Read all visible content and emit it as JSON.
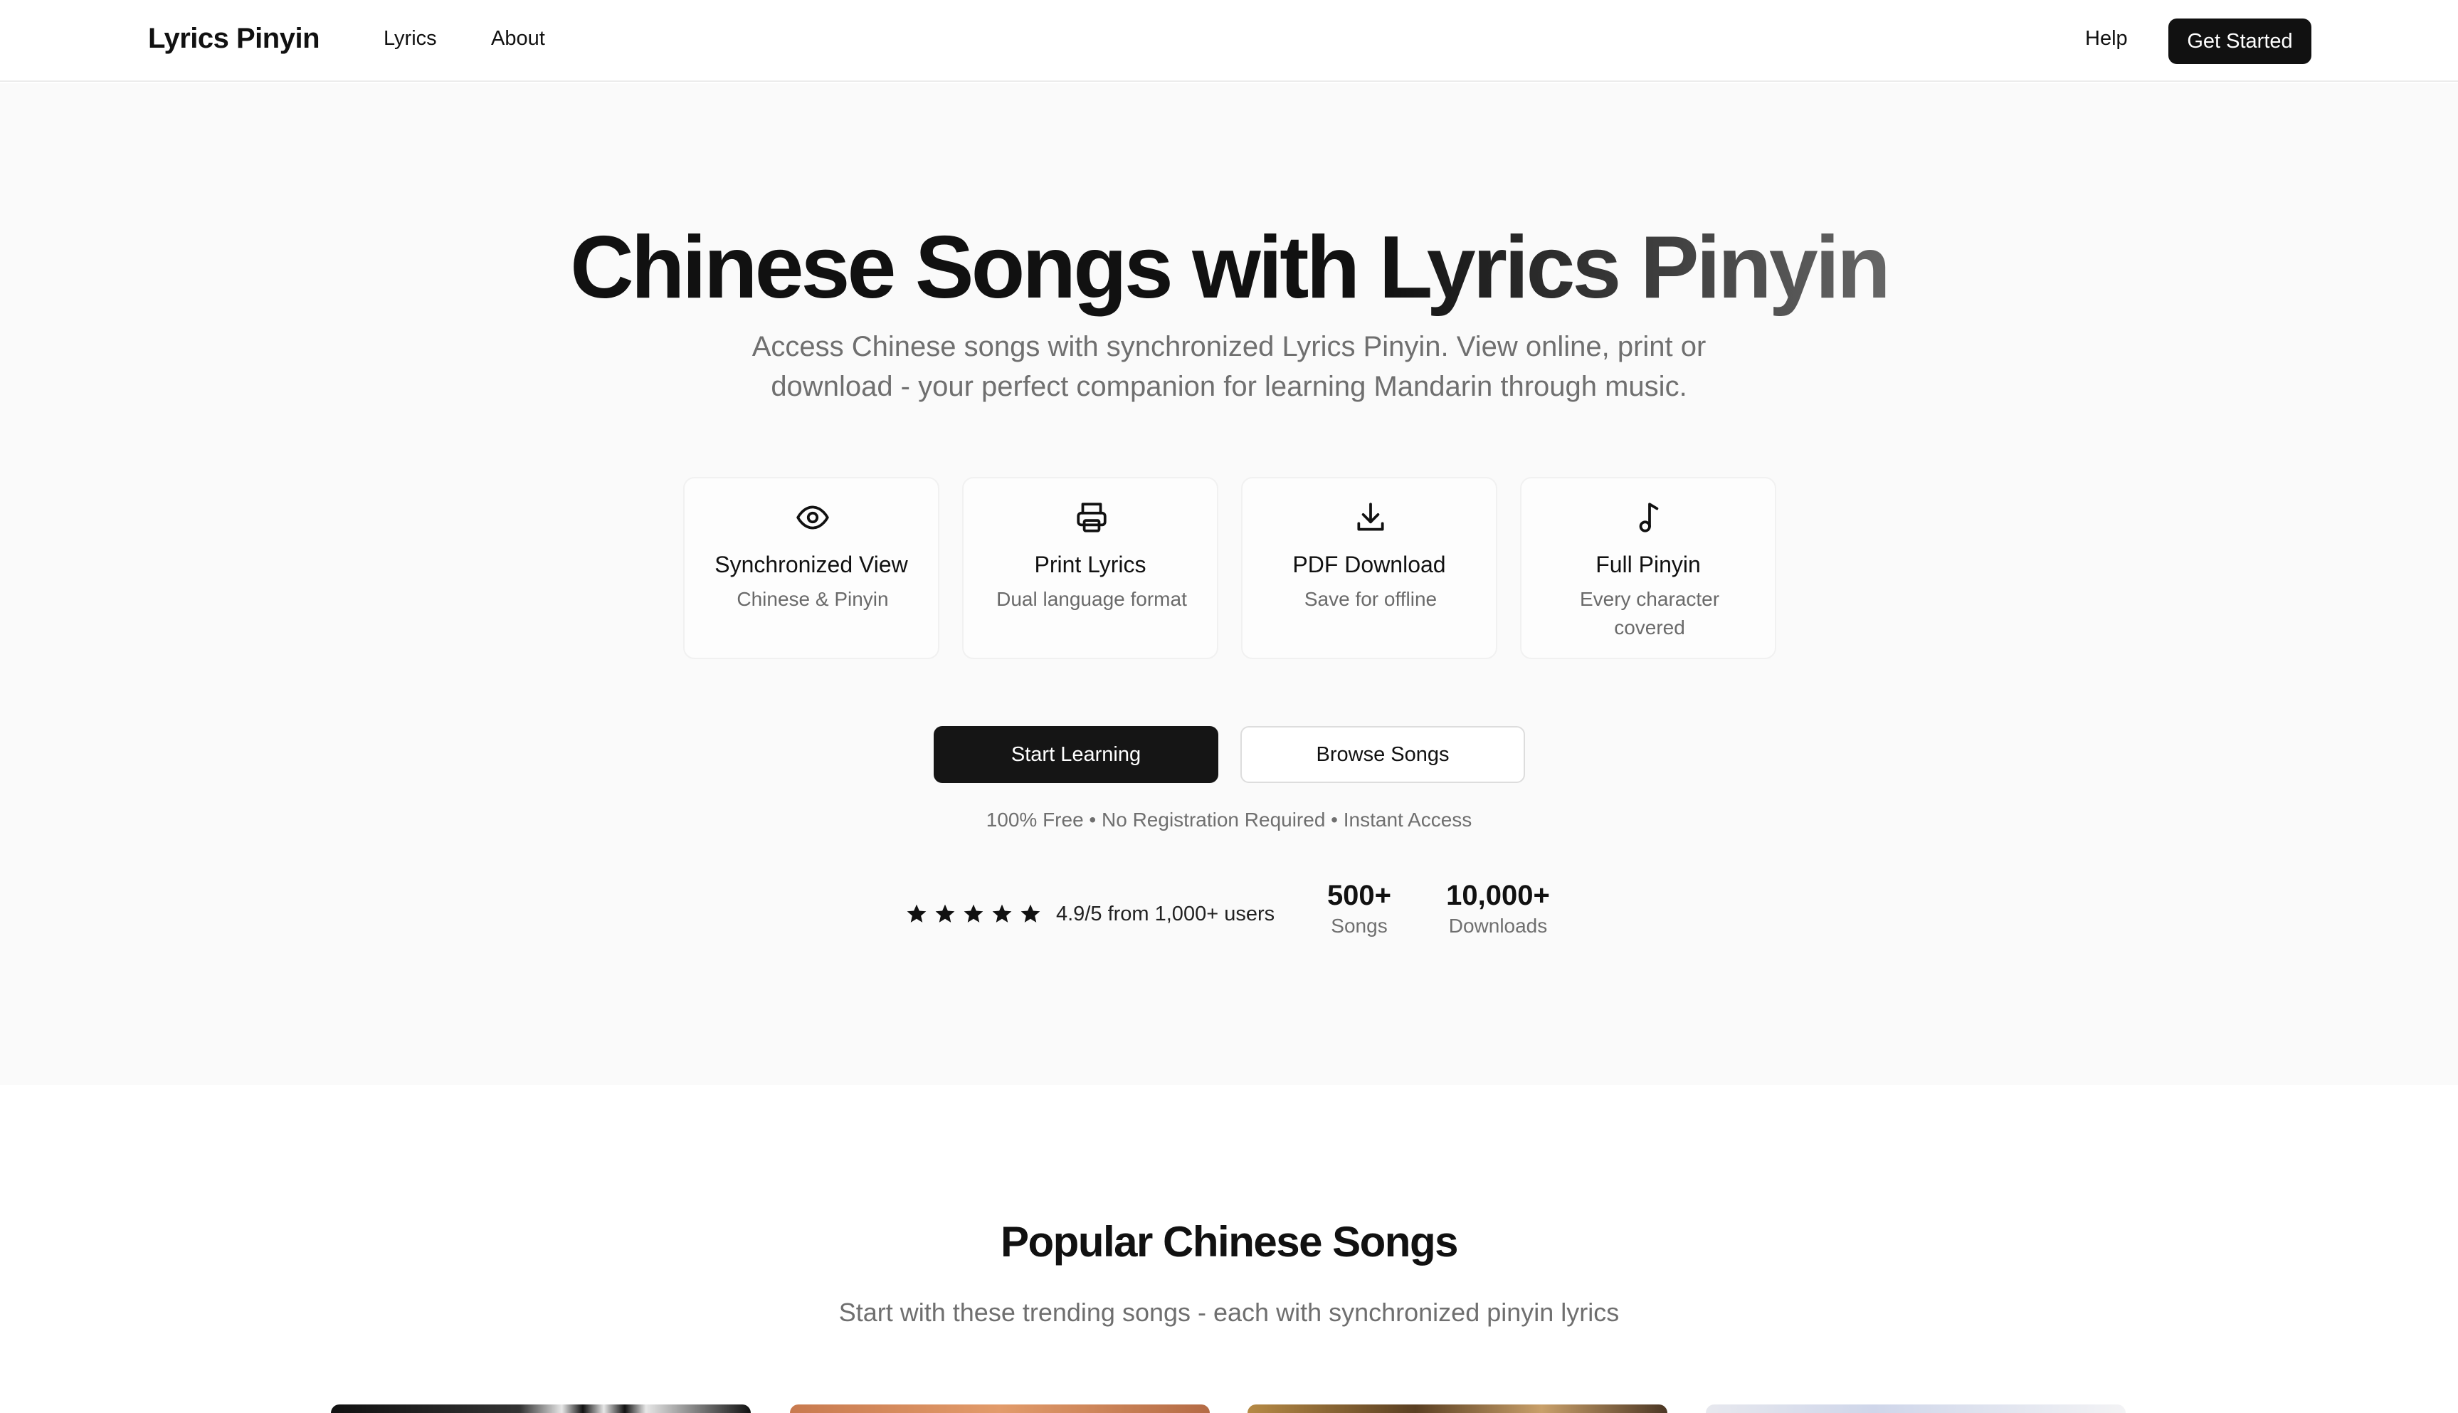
{
  "nav": {
    "logo": "Lyrics Pinyin",
    "links": [
      "Lyrics",
      "About"
    ],
    "help": "Help",
    "cta": "Get Started"
  },
  "hero": {
    "title_main": "Chinese Songs with ",
    "title_accent": "Lyrics Pinyin",
    "subtitle": "Access Chinese songs with synchronized Lyrics Pinyin. View online, print or download - your perfect companion for learning Mandarin through music.",
    "features": [
      {
        "icon": "eye-icon",
        "title": "Synchronized View",
        "desc": "Chinese & Pinyin"
      },
      {
        "icon": "printer-icon",
        "title": "Print Lyrics",
        "desc": "Dual language format"
      },
      {
        "icon": "download-icon",
        "title": "PDF Download",
        "desc": "Save for offline"
      },
      {
        "icon": "music-note-icon",
        "title": "Full Pinyin",
        "desc": "Every character covered"
      }
    ],
    "primary_button": "Start Learning",
    "secondary_button": "Browse Songs",
    "trust_line": "100% Free • No Registration Required • Instant Access",
    "rating": {
      "stars": 5,
      "score": "4.9/5",
      "from": "from",
      "users": "1,000+ users"
    },
    "stats": [
      {
        "value": "500+",
        "label": "Songs"
      },
      {
        "value": "10,000+",
        "label": "Downloads"
      }
    ]
  },
  "popular": {
    "title": "Popular Chinese Songs",
    "subtitle": "Start with these trending songs - each with synchronized pinyin lyrics"
  },
  "colors": {
    "primary": "#111111",
    "muted_text": "#6f6f6f",
    "hero_bg": "#fafafa"
  }
}
